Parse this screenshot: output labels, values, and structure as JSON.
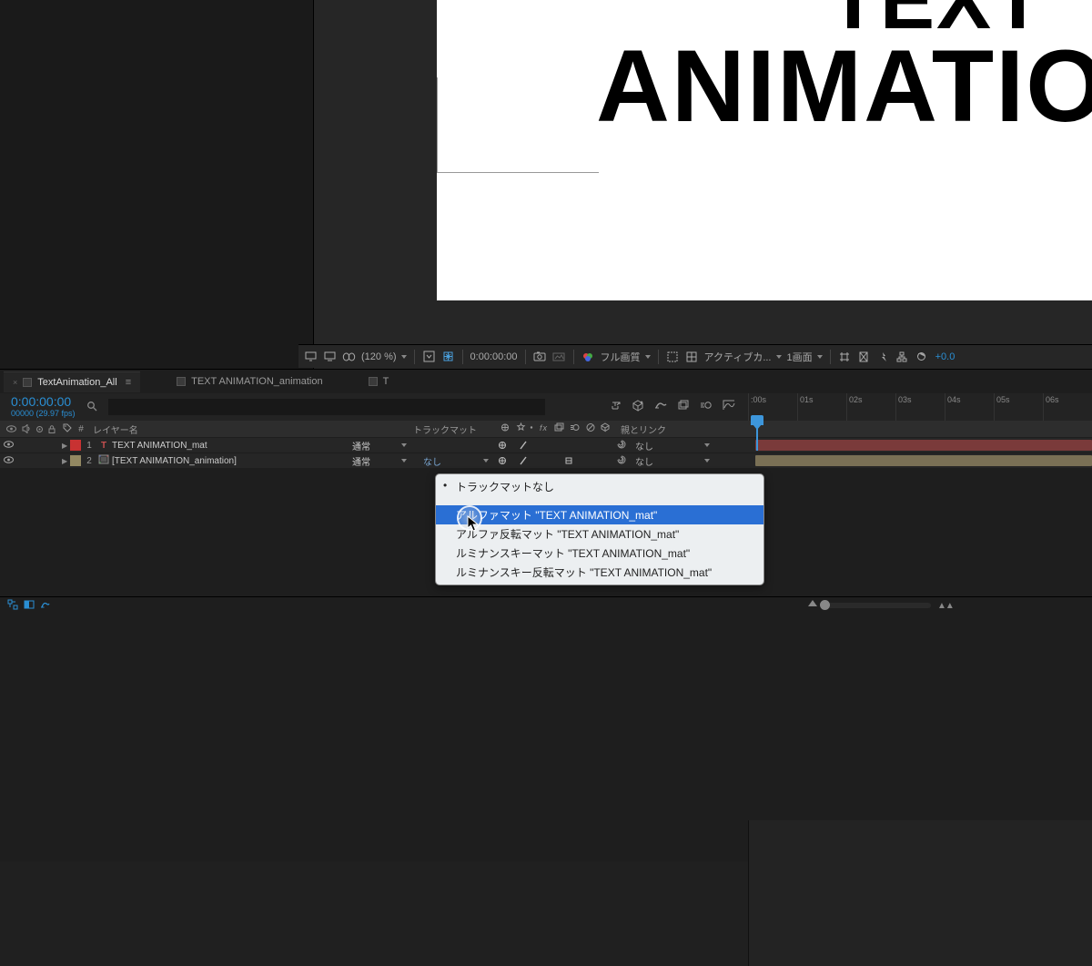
{
  "preview": {
    "text1": "TEXT",
    "text2": "ANIMATION"
  },
  "viewer_toolbar": {
    "zoom": "(120 %)",
    "time": "0:00:00:00",
    "quality": "フル画質",
    "camera": "アクティブカ...",
    "views": "1画面",
    "offset": "+0.0"
  },
  "tabs": [
    {
      "label": "TextAnimation_All",
      "active": true
    },
    {
      "label": "TEXT ANIMATION_animation",
      "active": false
    },
    {
      "label": "T",
      "active": false
    }
  ],
  "time": {
    "code": "0:00:00:00",
    "frames": "00000 (29.97 fps)"
  },
  "columns": {
    "layerName": "レイヤー名",
    "trackMatte": "トラックマット",
    "switches": "⊕ ✻ ㆍ fx 目 ◉ ⊘ ⊕",
    "parent": "親とリンク"
  },
  "layers": [
    {
      "num": "1",
      "color": "#c83232",
      "iconType": "T",
      "name": "TEXT ANIMATION_mat",
      "mode": "通常",
      "trkmat": "",
      "parent": "なし",
      "barClass": "red"
    },
    {
      "num": "2",
      "color": "#938862",
      "iconType": "comp",
      "name": "[TEXT ANIMATION_animation]",
      "mode": "通常",
      "trkmat": "なし",
      "parent": "なし",
      "barClass": "tan"
    }
  ],
  "ruler": [
    ":00s",
    "01s",
    "02s",
    "03s",
    "04s",
    "05s",
    "06s"
  ],
  "dropdown": {
    "items": [
      {
        "label": "トラックマットなし",
        "current": true,
        "hover": false
      },
      {
        "label": "アルファマット \"TEXT ANIMATION_mat\"",
        "current": false,
        "hover": true
      },
      {
        "label": "アルファ反転マット \"TEXT ANIMATION_mat\"",
        "current": false,
        "hover": false
      },
      {
        "label": "ルミナンスキーマット \"TEXT ANIMATION_mat\"",
        "current": false,
        "hover": false
      },
      {
        "label": "ルミナンスキー反転マット \"TEXT ANIMATION_mat\"",
        "current": false,
        "hover": false
      }
    ]
  }
}
